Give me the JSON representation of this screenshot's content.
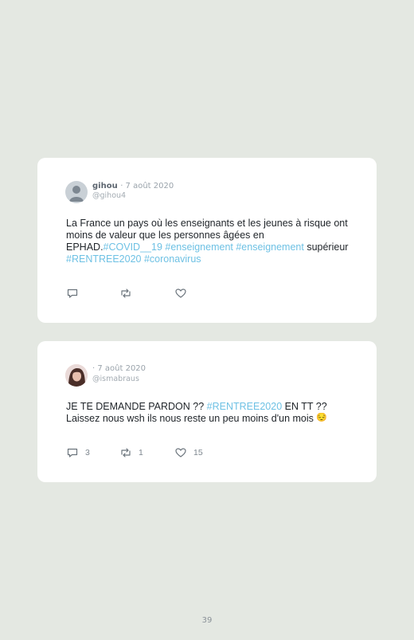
{
  "tweets": [
    {
      "author_name": "gihou",
      "date": "· 7 août 2020",
      "handle": "@gihou4",
      "text_parts": [
        {
          "text": "La France un pays où les enseignants et les jeunes à risque ont moins de valeur que les personnes âgées en EPHAD.",
          "type": "plain"
        },
        {
          "text": "#COVID__19",
          "type": "hashtag"
        },
        {
          "text": " ",
          "type": "plain"
        },
        {
          "text": "#enseignement",
          "type": "hashtag"
        },
        {
          "text": " ",
          "type": "plain"
        },
        {
          "text": "#enseignement",
          "type": "hashtag"
        },
        {
          "text": " supérieur ",
          "type": "plain"
        },
        {
          "text": "#RENTREE2020",
          "type": "hashtag"
        },
        {
          "text": " ",
          "type": "plain"
        },
        {
          "text": "#coronavirus",
          "type": "hashtag"
        }
      ],
      "avatar_icon": "default-user-icon",
      "replies": "",
      "retweets": "",
      "likes": ""
    },
    {
      "author_name": "",
      "date": "· 7 août 2020",
      "handle": "@ismabraus",
      "text_parts": [
        {
          "text": "JE TE DEMANDE PARDON ?? ",
          "type": "plain"
        },
        {
          "text": "#RENTREE2020",
          "type": "hashtag"
        },
        {
          "text": " EN TT ?? Laissez nous wsh ils nous reste un peu moins d'un mois ",
          "type": "plain"
        },
        {
          "text": "😔",
          "type": "emoji"
        }
      ],
      "avatar_icon": "user-photo-avatar",
      "replies": "3",
      "retweets": "1",
      "likes": "15"
    }
  ],
  "page_number": "39",
  "colors": {
    "background": "#e4e8e2",
    "card": "#ffffff",
    "hashtag": "#6ec1e4",
    "icon": "#6b747c"
  }
}
